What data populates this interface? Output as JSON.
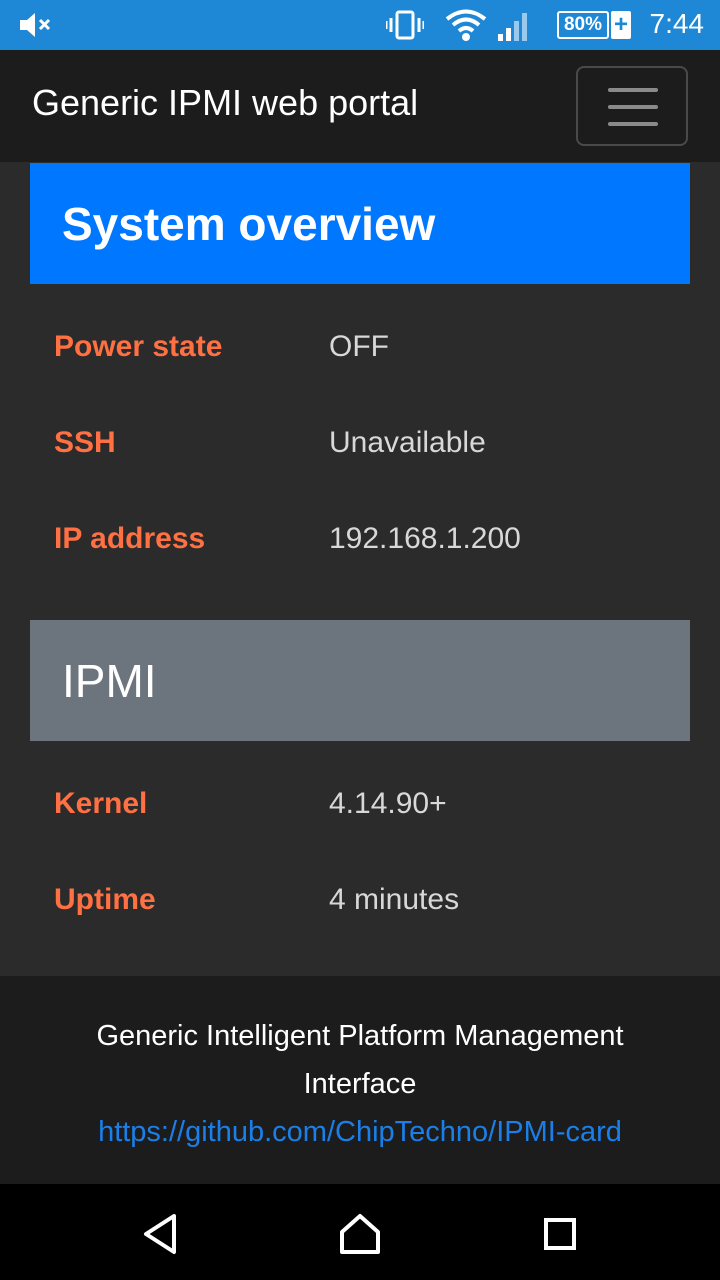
{
  "status_bar": {
    "time": "7:44",
    "battery_percent": "80%",
    "battery_plus": "+",
    "icons": [
      "mute-icon",
      "vibrate-icon",
      "wifi-icon",
      "signal-icon",
      "battery-icon"
    ],
    "color": "#1e88d6"
  },
  "navbar": {
    "brand": "Generic IPMI web portal",
    "toggler_icon": "hamburger-menu-icon"
  },
  "system_overview": {
    "title": "System overview",
    "header_color": "#0077ff",
    "rows": [
      {
        "label": "Power state",
        "value": "OFF"
      },
      {
        "label": "SSH",
        "value": "Unavailable"
      },
      {
        "label": "IP address",
        "value": "192.168.1.200"
      }
    ]
  },
  "ipmi": {
    "title": "IPMI",
    "header_color": "#6c757d",
    "rows": [
      {
        "label": "Kernel",
        "value": "4.14.90+"
      },
      {
        "label": "Uptime",
        "value": "4 minutes"
      }
    ]
  },
  "footer": {
    "text": "Generic Intelligent Platform Management Interface",
    "link": "https://github.com/ChipTechno/IPMI-card"
  },
  "android_nav": {
    "icons": [
      "back-icon",
      "home-icon",
      "recents-icon"
    ]
  },
  "colors": {
    "label": "#ff7043",
    "value": "#d8d8d8",
    "link": "#1a7fe8"
  }
}
